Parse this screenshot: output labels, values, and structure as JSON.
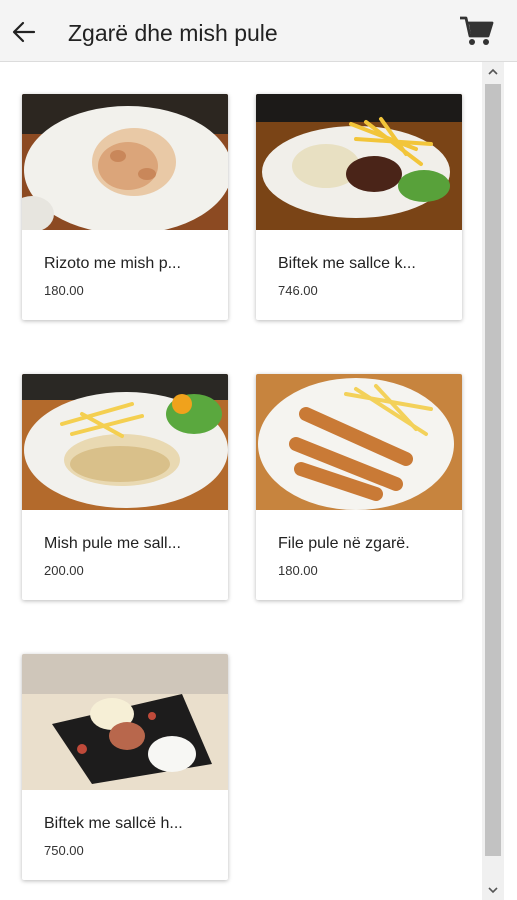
{
  "header": {
    "title": "Zgarë dhe mish pule",
    "back_icon": "arrow-left",
    "cart_icon": "shopping-cart"
  },
  "products": [
    {
      "name": "Rizoto me mish p...",
      "price": "180.00",
      "image": "risotto-plate"
    },
    {
      "name": "Biftek me sallce k...",
      "price": "746.00",
      "image": "steak-fries-plate"
    },
    {
      "name": "Mish pule me sall...",
      "price": "200.00",
      "image": "chicken-sauce-plate"
    },
    {
      "name": "File pule në zgarë.",
      "price": "180.00",
      "image": "chicken-strips-fries"
    },
    {
      "name": "Biftek me sallcë h...",
      "price": "750.00",
      "image": "steak-board"
    }
  ],
  "colors": {
    "header_bg": "#f4f4f4",
    "card_bg": "#ffffff",
    "scroll_thumb": "#c2c2c2",
    "table_wood": "#b5612a",
    "plate": "#f4f3ef"
  }
}
